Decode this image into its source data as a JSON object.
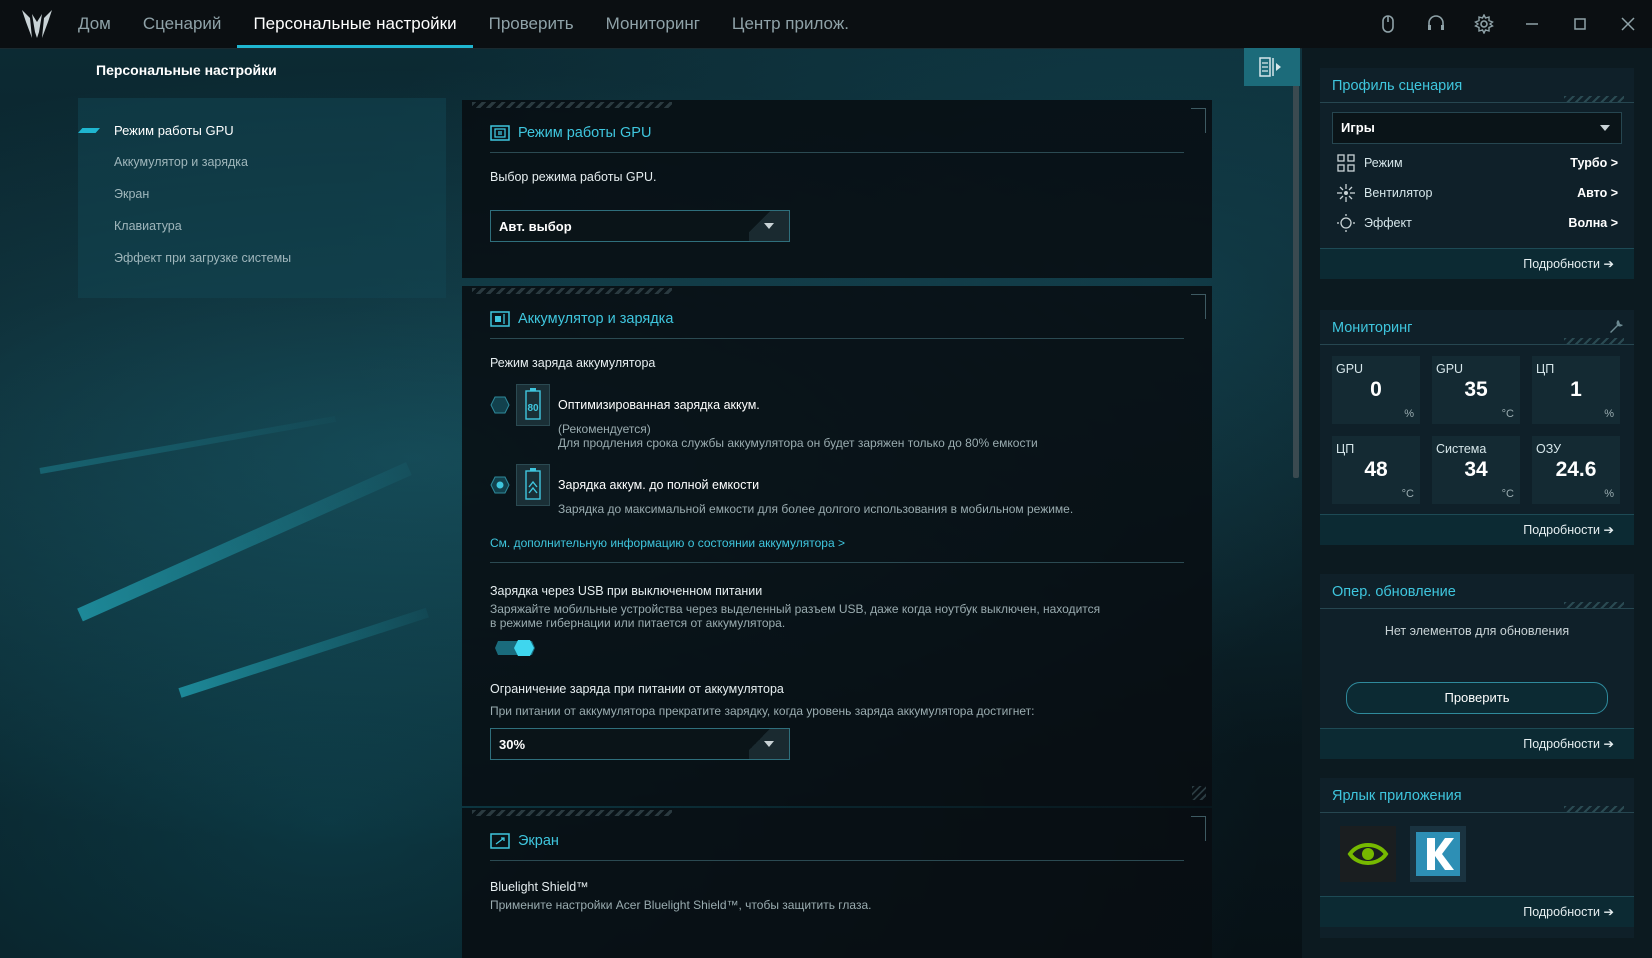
{
  "nav": {
    "tabs": [
      "Дом",
      "Сценарий",
      "Персональные настройки",
      "Проверить",
      "Мониторинг",
      "Центр прилож."
    ],
    "active_index": 2
  },
  "page_title": "Персональные настройки",
  "sidebar": {
    "items": [
      {
        "label": "Режим работы GPU",
        "active": true
      },
      {
        "label": "Аккумулятор и зарядка",
        "active": false
      },
      {
        "label": "Экран",
        "active": false
      },
      {
        "label": "Клавиатура",
        "active": false
      },
      {
        "label": "Эффект при загрузке системы",
        "active": false
      }
    ]
  },
  "gpu_card": {
    "title": "Режим работы GPU",
    "description": "Выбор режима работы GPU.",
    "dropdown_value": "Авт. выбор"
  },
  "battery_card": {
    "title": "Аккумулятор и зарядка",
    "charge_mode_label": "Режим заряда аккумулятора",
    "option1_title": "Оптимизированная зарядка аккум.",
    "option1_badge": "80",
    "option1_recommended": "(Рекомендуется)",
    "option1_desc": "Для продления срока службы аккумулятора он будет заряжен только до 80% емкости",
    "option2_title": "Зарядка аккум. до полной емкости",
    "option2_desc": "Зарядка до максимальной емкости для более долгого использования в мобильном режиме.",
    "selected_option": 2,
    "more_link": "См. дополнительную информацию о состоянии аккумулятора >",
    "usb_title": "Зарядка через USB при выключенном питании",
    "usb_desc_1": "Заряжайте мобильные устройства через выделенный разъем USB, даже когда ноутбук выключен, находится",
    "usb_desc_2": "в режиме гибернации или питается от аккумулятора.",
    "usb_toggle_on": true,
    "limit_title": "Ограничение заряда при питании от аккумулятора",
    "limit_desc": "При питании от аккумулятора прекратите зарядку, когда уровень заряда аккумулятора достигнет:",
    "limit_value": "30%"
  },
  "screen_card": {
    "title": "Экран",
    "bluelight_title": "Bluelight Shield™",
    "bluelight_desc": "Примените настройки Acer Bluelight Shield™, чтобы защитить глаза."
  },
  "right": {
    "profile": {
      "title": "Профиль сценария",
      "selected": "Игры",
      "rows": [
        {
          "label": "Режим",
          "value": "Турбо >",
          "icon": "grid-icon"
        },
        {
          "label": "Вентилятор",
          "value": "Авто >",
          "icon": "fan-icon"
        },
        {
          "label": "Эффект",
          "value": "Волна >",
          "icon": "sun-icon"
        }
      ],
      "more": "Подробности"
    },
    "monitoring": {
      "title": "Мониторинг",
      "stats": [
        {
          "name": "GPU",
          "value": "0",
          "unit": "%"
        },
        {
          "name": "GPU",
          "value": "35",
          "unit": "°C"
        },
        {
          "name": "ЦП",
          "value": "1",
          "unit": "%"
        },
        {
          "name": "ЦП",
          "value": "48",
          "unit": "°C"
        },
        {
          "name": "Система",
          "value": "34",
          "unit": "°C"
        },
        {
          "name": "ОЗУ",
          "value": "24.6",
          "unit": "%"
        }
      ],
      "more": "Подробности"
    },
    "update": {
      "title": "Опер. обновление",
      "status": "Нет элементов для обновления",
      "button": "Проверить",
      "more": "Подробности"
    },
    "shortcuts": {
      "title": "Ярлык приложения",
      "apps": [
        "nvidia-icon",
        "k-app-icon"
      ],
      "more": "Подробности"
    }
  },
  "colors": {
    "accent": "#1fb6d0",
    "title_accent": "#3fc6de",
    "nvidia_green": "#76b900"
  }
}
